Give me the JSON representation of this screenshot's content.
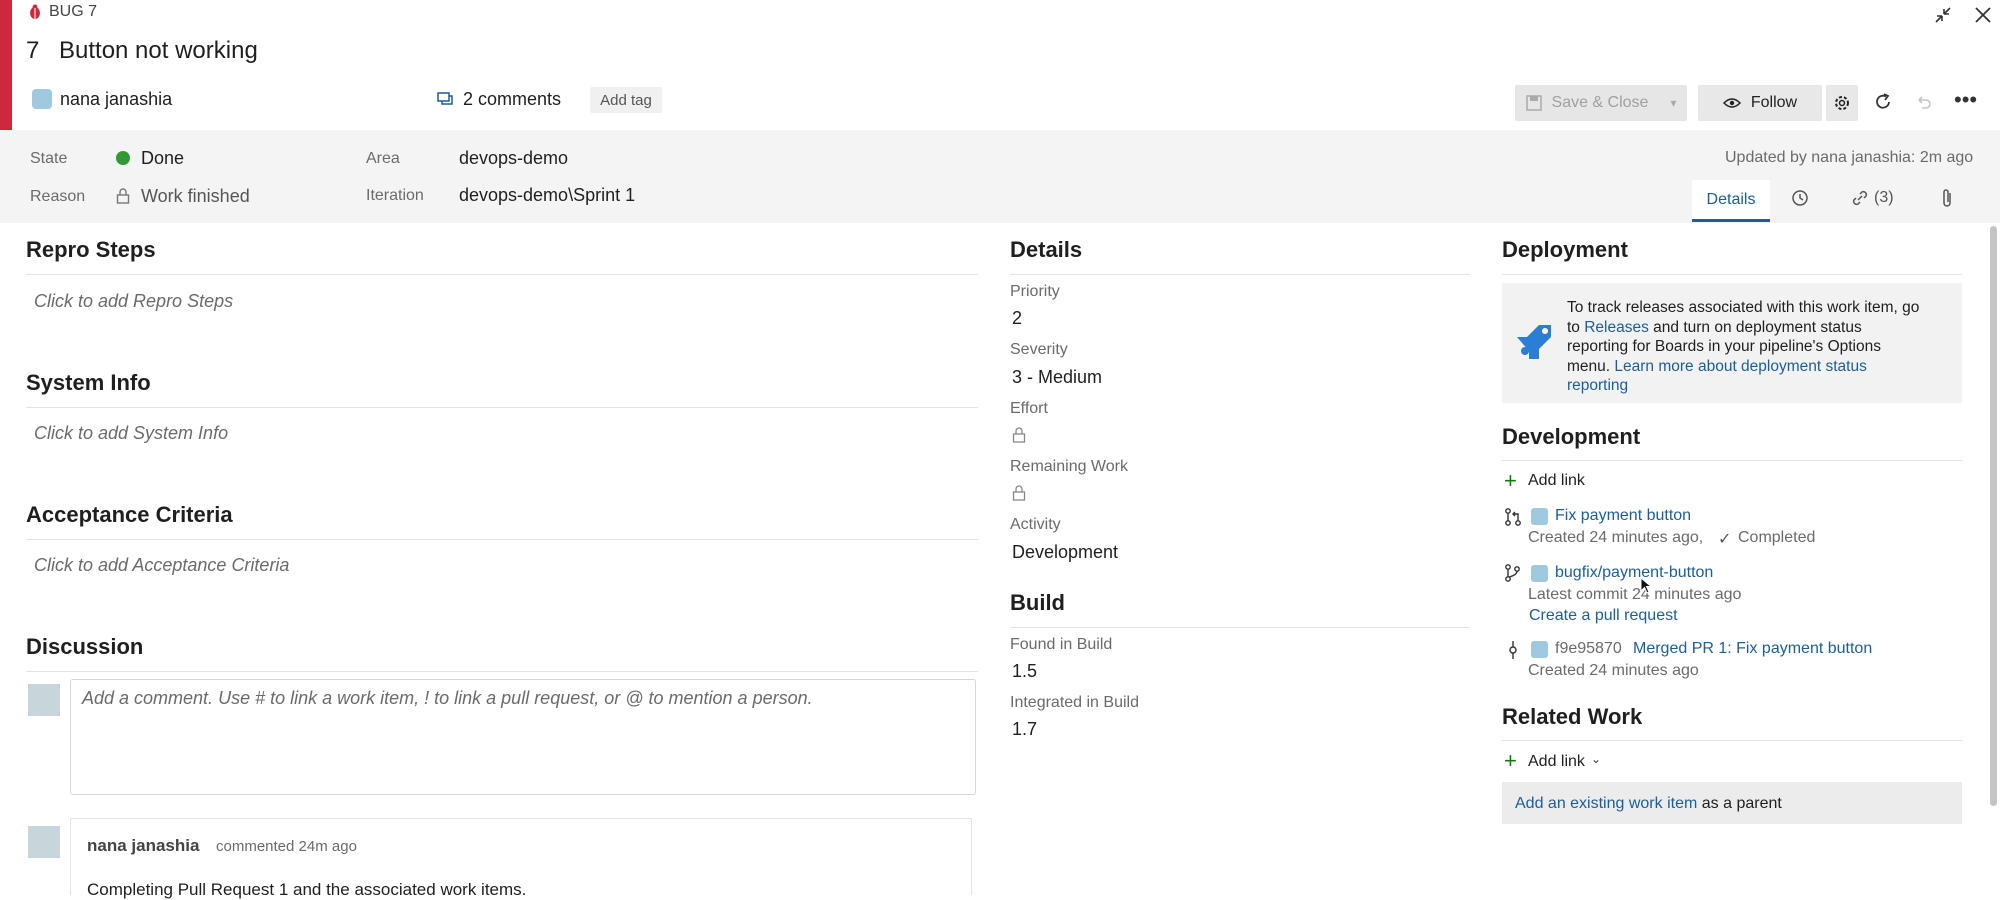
{
  "header": {
    "type_label": "BUG 7",
    "item_id": "7",
    "title": "Button not working",
    "assignee": "nana janashia",
    "comments": "2 comments",
    "add_tag": "Add tag",
    "save_close": "Save & Close",
    "follow": "Follow"
  },
  "fields": {
    "state_label": "State",
    "state_value": "Done",
    "state_color": "#339933",
    "reason_label": "Reason",
    "reason_value": "Work finished",
    "area_label": "Area",
    "area_value": "devops-demo",
    "iteration_label": "Iteration",
    "iteration_value": "devops-demo\\Sprint 1",
    "updated": "Updated by nana janashia: 2m ago"
  },
  "tabs": {
    "details": "Details",
    "links_count": "(3)"
  },
  "left": {
    "repro_title": "Repro Steps",
    "repro_ph": "Click to add Repro Steps",
    "sysinfo_title": "System Info",
    "sysinfo_ph": "Click to add System Info",
    "accept_title": "Acceptance Criteria",
    "accept_ph": "Click to add Acceptance Criteria",
    "discussion_title": "Discussion",
    "comment_ph": "Add a comment. Use # to link a work item, ! to link a pull request, or @ to mention a person.",
    "comment_author": "nana janashia",
    "comment_meta": "commented 24m ago",
    "comment_text": "Completing Pull Request 1 and the associated work items."
  },
  "details": {
    "title": "Details",
    "priority_label": "Priority",
    "priority_value": "2",
    "severity_label": "Severity",
    "severity_value": "3 - Medium",
    "effort_label": "Effort",
    "remaining_label": "Remaining Work",
    "activity_label": "Activity",
    "activity_value": "Development",
    "build_title": "Build",
    "found_label": "Found in Build",
    "found_value": "1.5",
    "integrated_label": "Integrated in Build",
    "integrated_value": "1.7"
  },
  "deployment": {
    "title": "Deployment",
    "text1": "To track releases associated with this work item, go",
    "text2a": "to ",
    "releases_link": "Releases",
    "text2b": " and turn on deployment status",
    "text3": "reporting for Boards in your pipeline's Options",
    "text4a": "menu. ",
    "learn_link_1": "Learn more about deployment status",
    "learn_link_2": "reporting"
  },
  "development": {
    "title": "Development",
    "add_link": "Add link",
    "items": [
      {
        "title": "Fix payment button",
        "meta": "Created 24 minutes ago,",
        "status": "Completed"
      },
      {
        "title": "bugfix/payment-button",
        "meta": "Latest commit 24 minutes ago",
        "action": "Create a pull request"
      },
      {
        "hash": "f9e95870",
        "title": "Merged PR 1: Fix payment button",
        "meta": "Created 24 minutes ago"
      }
    ]
  },
  "related": {
    "title": "Related Work",
    "add_link": "Add link",
    "existing_link": "Add an existing work item",
    "as_parent": " as a parent"
  },
  "colors": {
    "bug_red": "#cc293d",
    "link_blue": "#1b5e9c",
    "add_green": "#107c10"
  }
}
